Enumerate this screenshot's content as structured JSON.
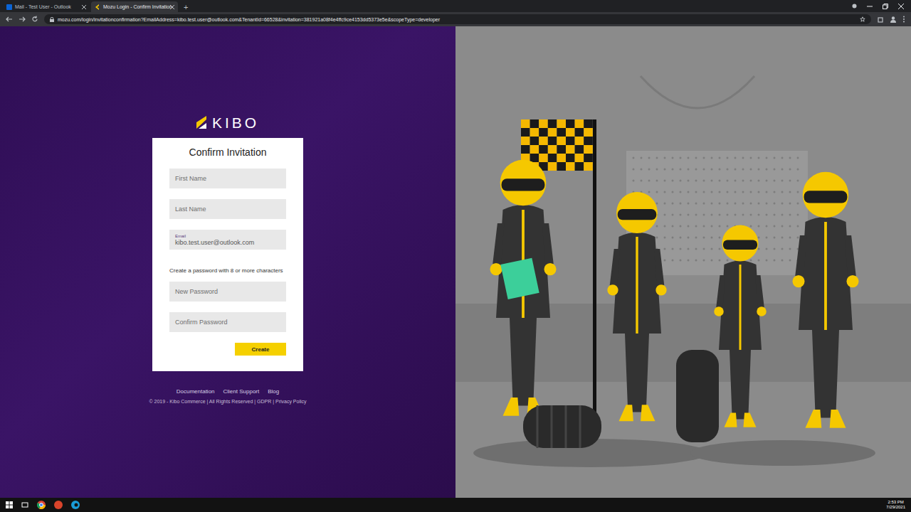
{
  "browser": {
    "tabs": [
      {
        "label": "Mail - Test User - Outlook",
        "selected": false
      },
      {
        "label": "Mozu Login - Confirm Invitation",
        "selected": true
      }
    ],
    "new_tab": "+",
    "url": "mozu.com/login/invitationconfirmation?EmailAddress=kibo.test.user@outlook.com&TenantId=66528&invitation=381921a08f4e4ffc9ce4153dd5373e5e&scopeType=developer"
  },
  "logo": {
    "text": "KIBO"
  },
  "form": {
    "title": "Confirm Invitation",
    "name_fields": [
      {
        "kind": "empty",
        "label": "",
        "text": "First Name"
      },
      {
        "kind": "empty",
        "label": "",
        "text": "Last Name"
      },
      {
        "kind": "filled",
        "label": "Email",
        "text": "kibo.test.user@outlook.com"
      }
    ],
    "password_hint": "Create a password with 8 or more characters",
    "password_fields": [
      {
        "kind": "empty",
        "label": "",
        "text": "New Password"
      },
      {
        "kind": "empty",
        "label": "",
        "text": "Confirm Password"
      }
    ],
    "submit": "Create"
  },
  "footer": {
    "links": [
      "Documentation",
      "Client Support",
      "Blog"
    ],
    "copyright": "© 2019 - Kibo Commerce | All Rights Reserved | GDPR | Privacy Policy"
  },
  "taskbar": {
    "time": "2:53 PM",
    "date": "7/29/2021"
  }
}
